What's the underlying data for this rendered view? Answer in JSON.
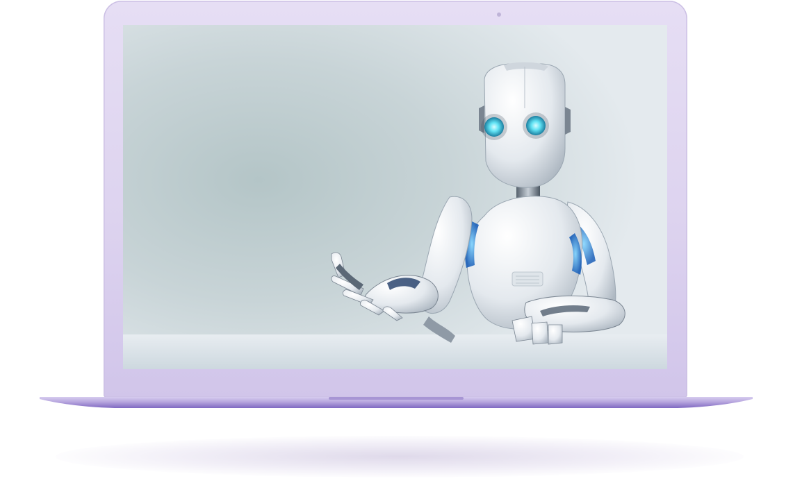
{
  "scene": {
    "device": "laptop-icon",
    "subject": "robot-icon"
  },
  "colors": {
    "frame": "#ddd3ef",
    "base": "#b7a6de",
    "base_edge": "#7f68c2",
    "robot_eye": "#62e3f4",
    "robot_glow": "#2aa8ff",
    "background": "#c9d5d8"
  }
}
